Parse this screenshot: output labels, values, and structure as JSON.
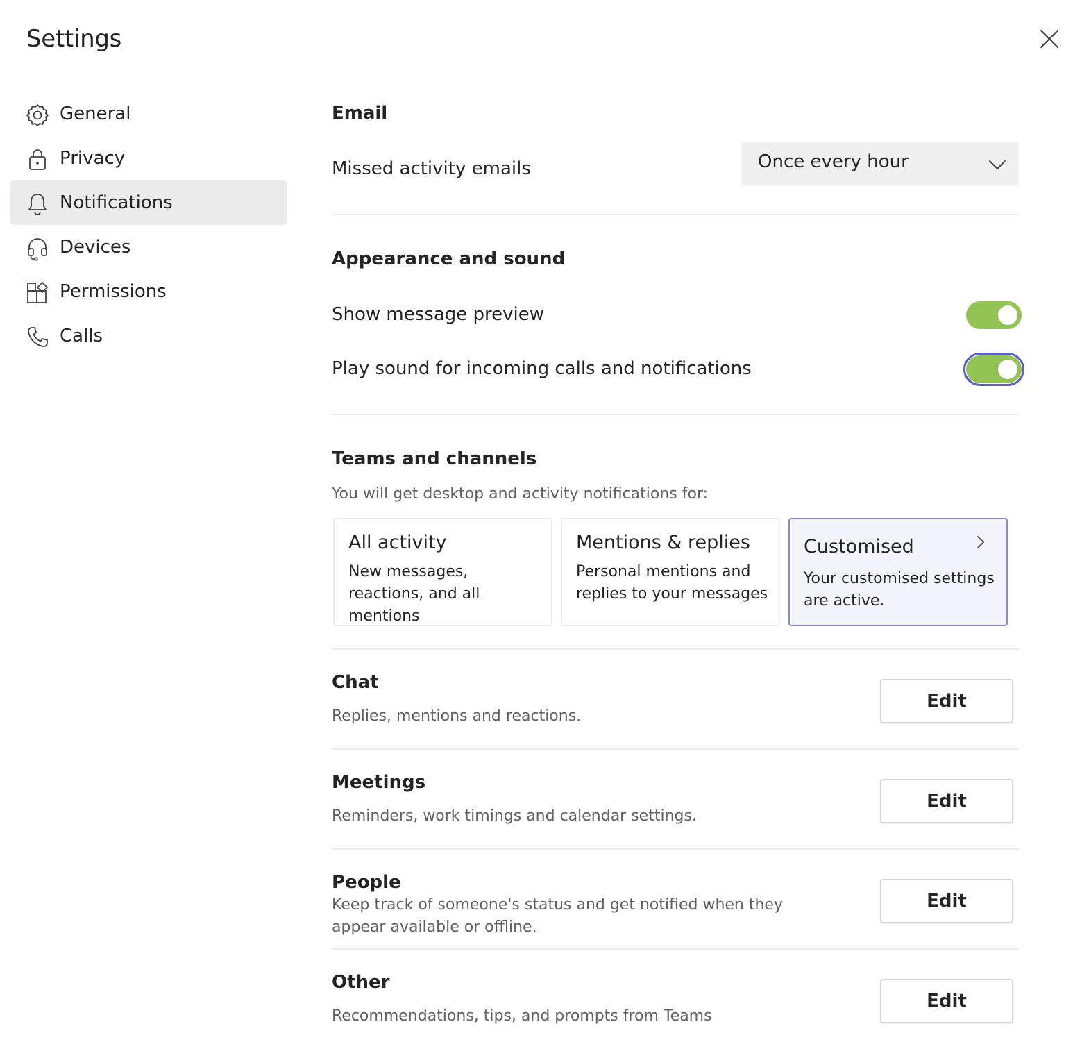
{
  "window": {
    "title": "Settings",
    "close_icon": "close-icon"
  },
  "sidebar": {
    "items": [
      {
        "label": "General",
        "icon": "gear-icon",
        "active": false
      },
      {
        "label": "Privacy",
        "icon": "lock-icon",
        "active": false
      },
      {
        "label": "Notifications",
        "icon": "bell-icon",
        "active": true
      },
      {
        "label": "Devices",
        "icon": "headset-icon",
        "active": false
      },
      {
        "label": "Permissions",
        "icon": "apps-icon",
        "active": false
      },
      {
        "label": "Calls",
        "icon": "phone-icon",
        "active": false
      }
    ]
  },
  "email": {
    "heading": "Email",
    "missed_label": "Missed activity emails",
    "missed_value": "Once every hour"
  },
  "appearance": {
    "heading": "Appearance and sound",
    "preview_label": "Show message preview",
    "preview_on": true,
    "sound_label": "Play sound for incoming calls and notifications",
    "sound_on": true
  },
  "teams": {
    "heading": "Teams and channels",
    "description": "You will get desktop and activity notifications for:",
    "options": [
      {
        "title": "All activity",
        "desc": "New messages, reactions, and all mentions",
        "selected": false
      },
      {
        "title": "Mentions & replies",
        "desc": "Personal mentions and replies to your messages",
        "selected": false
      },
      {
        "title": "Customised",
        "desc": "Your customised settings are active.",
        "selected": true
      }
    ]
  },
  "sections": [
    {
      "title": "Chat",
      "desc": "Replies, mentions and reactions.",
      "button": "Edit"
    },
    {
      "title": "Meetings",
      "desc": "Reminders, work timings and calendar settings.",
      "button": "Edit"
    },
    {
      "title": "People",
      "desc": "Keep track of someone's status and get notified when they appear available or offline.",
      "button": "Edit"
    },
    {
      "title": "Other",
      "desc": "Recommendations, tips, and prompts from Teams",
      "button": "Edit"
    }
  ],
  "colors": {
    "toggle_on": "#92c353",
    "focus_ring": "#5b5fc7",
    "selected_card_border": "#8b8cc7",
    "active_nav_bg": "#ebebeb"
  }
}
